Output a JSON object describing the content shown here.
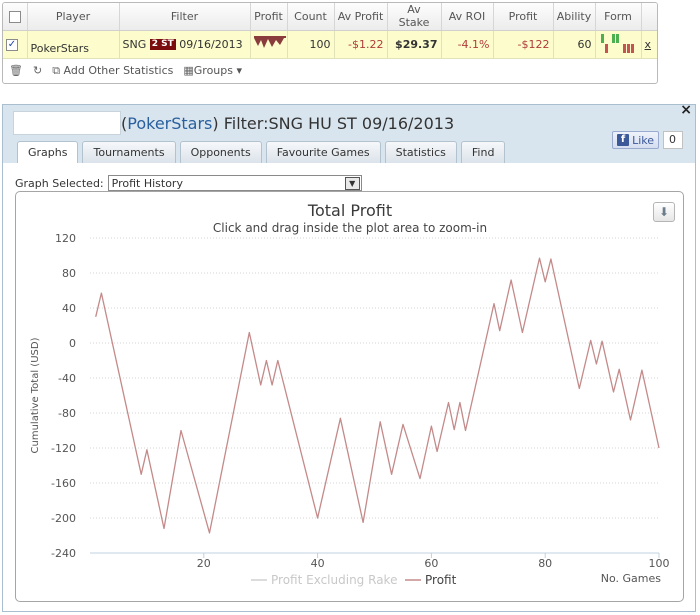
{
  "stats": {
    "columns": [
      "",
      "Player",
      "Filter",
      "Profit",
      "Count",
      "Av Profit",
      "Av Stake",
      "Av ROI",
      "Profit",
      "Ability",
      "Form",
      ""
    ],
    "row": {
      "selected_mark": "✓",
      "player": "PokerStars",
      "filter_prefix": "SNG",
      "filter_badge": "2 ST",
      "filter_date": "09/16/2013",
      "count": "100",
      "av_profit": "-$1.22",
      "av_stake": "$29.37",
      "av_roi": "-4.1%",
      "profit": "-$122",
      "ability": "60",
      "close": "x"
    },
    "toolbar": {
      "add_stats": "Add Other Statistics",
      "groups": "Groups"
    }
  },
  "window": {
    "title_open": "(",
    "site": "PokerStars",
    "title_rest": ") Filter:SNG HU ST 09/16/2013",
    "close": "×",
    "like_label": "Like",
    "like_count": "0",
    "tabs": [
      "Graphs",
      "Tournaments",
      "Opponents",
      "Favourite Games",
      "Statistics",
      "Find"
    ],
    "active_tab": 0,
    "graph_selected_label": "Graph Selected:",
    "graph_selected_value": "Profit History"
  },
  "chart_data": {
    "type": "line",
    "title": "Total Profit",
    "subtitle": "Click and drag inside the plot area to zoom-in",
    "xlabel": "No. Games",
    "ylabel": "Cumulative Total (USD)",
    "xlim": [
      0,
      100
    ],
    "ylim": [
      -240,
      120
    ],
    "xticks": [
      20,
      40,
      60,
      80,
      100
    ],
    "yticks": [
      120,
      80,
      40,
      0,
      -40,
      -80,
      -120,
      -160,
      -200,
      -240
    ],
    "grid": true,
    "legend_position": "bottom-center",
    "series": [
      {
        "name": "Profit Excluding Rake",
        "color": "#d0d0d0",
        "points": []
      },
      {
        "name": "Profit",
        "color": "#c48a8a",
        "points": [
          [
            1,
            30
          ],
          [
            2,
            57
          ],
          [
            9,
            -150
          ],
          [
            10,
            -122
          ],
          [
            13,
            -212
          ],
          [
            16,
            -100
          ],
          [
            21,
            -217
          ],
          [
            28,
            12
          ],
          [
            30,
            -48
          ],
          [
            31,
            -20
          ],
          [
            32,
            -48
          ],
          [
            33,
            -20
          ],
          [
            40,
            -200
          ],
          [
            44,
            -86
          ],
          [
            48,
            -205
          ],
          [
            51,
            -90
          ],
          [
            53,
            -150
          ],
          [
            55,
            -93
          ],
          [
            58,
            -155
          ],
          [
            60,
            -95
          ],
          [
            61,
            -124
          ],
          [
            63,
            -68
          ],
          [
            64,
            -99
          ],
          [
            65,
            -68
          ],
          [
            66,
            -100
          ],
          [
            71,
            45
          ],
          [
            72,
            14
          ],
          [
            74,
            72
          ],
          [
            76,
            12
          ],
          [
            79,
            97
          ],
          [
            80,
            70
          ],
          [
            81,
            96
          ],
          [
            86,
            -52
          ],
          [
            88,
            3
          ],
          [
            89,
            -24
          ],
          [
            90,
            2
          ],
          [
            92,
            -56
          ],
          [
            93,
            -30
          ],
          [
            95,
            -88
          ],
          [
            97,
            -31
          ],
          [
            100,
            -120
          ]
        ]
      }
    ]
  }
}
